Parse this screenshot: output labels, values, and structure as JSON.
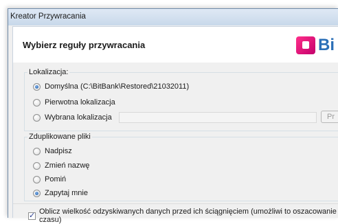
{
  "window": {
    "title": "Kreator Przywracania"
  },
  "header": {
    "title": "Wybierz reguły przywracania",
    "logo_text": "Bi"
  },
  "location": {
    "legend": "Lokalizacja:",
    "options": [
      {
        "label": "Domyślna (C:\\BitBank\\Restored\\21032011)",
        "checked": true
      },
      {
        "label": "Pierwotna lokalizacja",
        "checked": false
      },
      {
        "label": "Wybrana lokalizacja",
        "checked": false
      }
    ],
    "path_value": "",
    "browse_label": "Pr"
  },
  "duplicates": {
    "legend": "Zduplikowane pliki",
    "options": [
      {
        "label": "Nadpisz",
        "checked": false
      },
      {
        "label": "Zmień nazwę",
        "checked": false
      },
      {
        "label": "Pomiń",
        "checked": false
      },
      {
        "label": "Zapytaj mnie",
        "checked": true
      }
    ]
  },
  "estimate": {
    "label": "Oblicz wielkość odzyskiwanych danych przed ich ściągnięciem (umożliwi to oszacowanie czasu)",
    "checked": true
  }
}
